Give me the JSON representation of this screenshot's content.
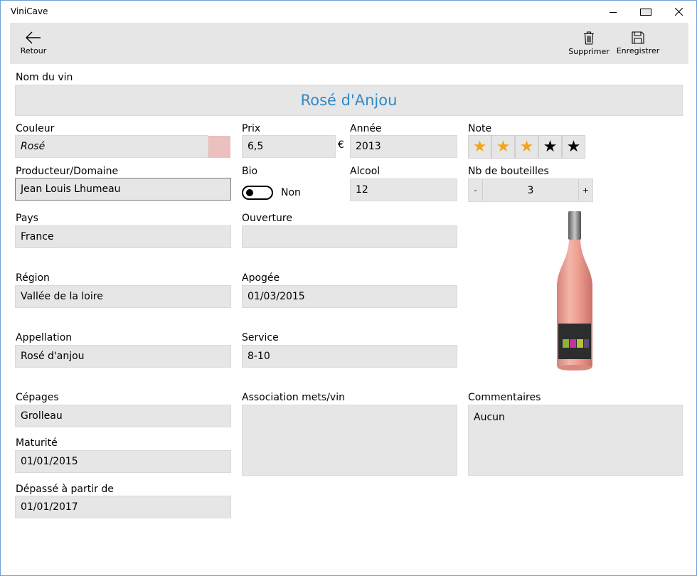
{
  "window": {
    "title": "ViniCave"
  },
  "commandbar": {
    "back_label": "Retour",
    "delete_label": "Supprimer",
    "save_label": "Enregistrer"
  },
  "fields": {
    "name": {
      "label": "Nom du vin",
      "value": "Rosé d'Anjou"
    },
    "color": {
      "label": "Couleur",
      "value": "Rosé",
      "swatch": "#ebc0bd"
    },
    "price": {
      "label": "Prix",
      "value": "6,5",
      "currency": "€"
    },
    "year": {
      "label": "Année",
      "value": "2013"
    },
    "rating": {
      "label": "Note",
      "value": 3,
      "max": 5,
      "star_on": "★",
      "star_off": "★",
      "on_color": "#f4a41a"
    },
    "producer": {
      "label": "Producteur/Domaine",
      "value": "Jean Louis Lhumeau"
    },
    "bio": {
      "label": "Bio",
      "state": "Non"
    },
    "alcohol": {
      "label": "Alcool",
      "value": "12"
    },
    "bottles": {
      "label": "Nb de bouteilles",
      "value": "3",
      "minus": "-",
      "plus": "+"
    },
    "country": {
      "label": "Pays",
      "value": "France"
    },
    "opening": {
      "label": "Ouverture",
      "value": ""
    },
    "region": {
      "label": "Région",
      "value": "Vallée de la loire"
    },
    "apogee": {
      "label": "Apogée",
      "value": "01/03/2015"
    },
    "appellation": {
      "label": "Appellation",
      "value": "Rosé d'anjou"
    },
    "service": {
      "label": "Service",
      "value": "8-10"
    },
    "grapes": {
      "label": "Cépages",
      "value": "Grolleau"
    },
    "pairing": {
      "label": "Association mets/vin",
      "value": ""
    },
    "comments": {
      "label": "Commentaires",
      "value": "Aucun"
    },
    "maturity": {
      "label": "Maturité",
      "value": "01/01/2015"
    },
    "past": {
      "label": "Dépassé à partir de",
      "value": "01/01/2017"
    }
  },
  "colors": {
    "accent": "#3188c7",
    "field_bg": "#e6e6e6",
    "bar_bg": "#e6e6e6"
  }
}
